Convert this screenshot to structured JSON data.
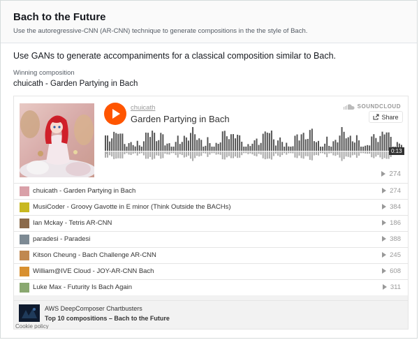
{
  "header": {
    "title": "Bach to the Future",
    "subtitle": "Use the autoregressive-CNN (AR-CNN) technique to generate compositions in the the style of Bach."
  },
  "intro": "Use GANs to generate accompaniments for a classical composition similar to Bach.",
  "winning": {
    "label": "Winning composition",
    "value": "chuicath - Garden Partying in Bach"
  },
  "player": {
    "uploader": "chuicath",
    "track_title": "Garden Partying in Bach",
    "brand": "SOUNDCLOUD",
    "share_label": "Share",
    "duration": "0:13",
    "dash": "-",
    "play_count": "274",
    "tracks": [
      {
        "name": "chuicath - Garden Partying in Bach",
        "count": "274",
        "color": "#d9a0a8"
      },
      {
        "name": "MusiCoder - Groovy Gavotte in E minor (Think Outside the BACHs)",
        "count": "384",
        "color": "#c8b820"
      },
      {
        "name": "Ian Mckay - Tetris AR-CNN",
        "count": "186",
        "color": "#8b6a4a"
      },
      {
        "name": "paradesi - Paradesi",
        "count": "388",
        "color": "#7d8a94"
      },
      {
        "name": "Kitson Cheung - Bach Challenge AR-CNN",
        "count": "245",
        "color": "#c08850"
      },
      {
        "name": "William@IVE Cloud - JOY-AR-CNN Bach",
        "count": "608",
        "color": "#d89030"
      },
      {
        "name": "Luke Max - Futurity Is Bach Again",
        "count": "311",
        "color": "#8aa870"
      }
    ],
    "footer": {
      "line1": "AWS DeepComposer Chartbusters",
      "line2": "Top 10 compositions – Bach to the Future"
    },
    "cookie": "Cookie policy"
  },
  "colors": {
    "accent": "#ff5500",
    "text": "#16191f",
    "muted": "#545b64"
  }
}
